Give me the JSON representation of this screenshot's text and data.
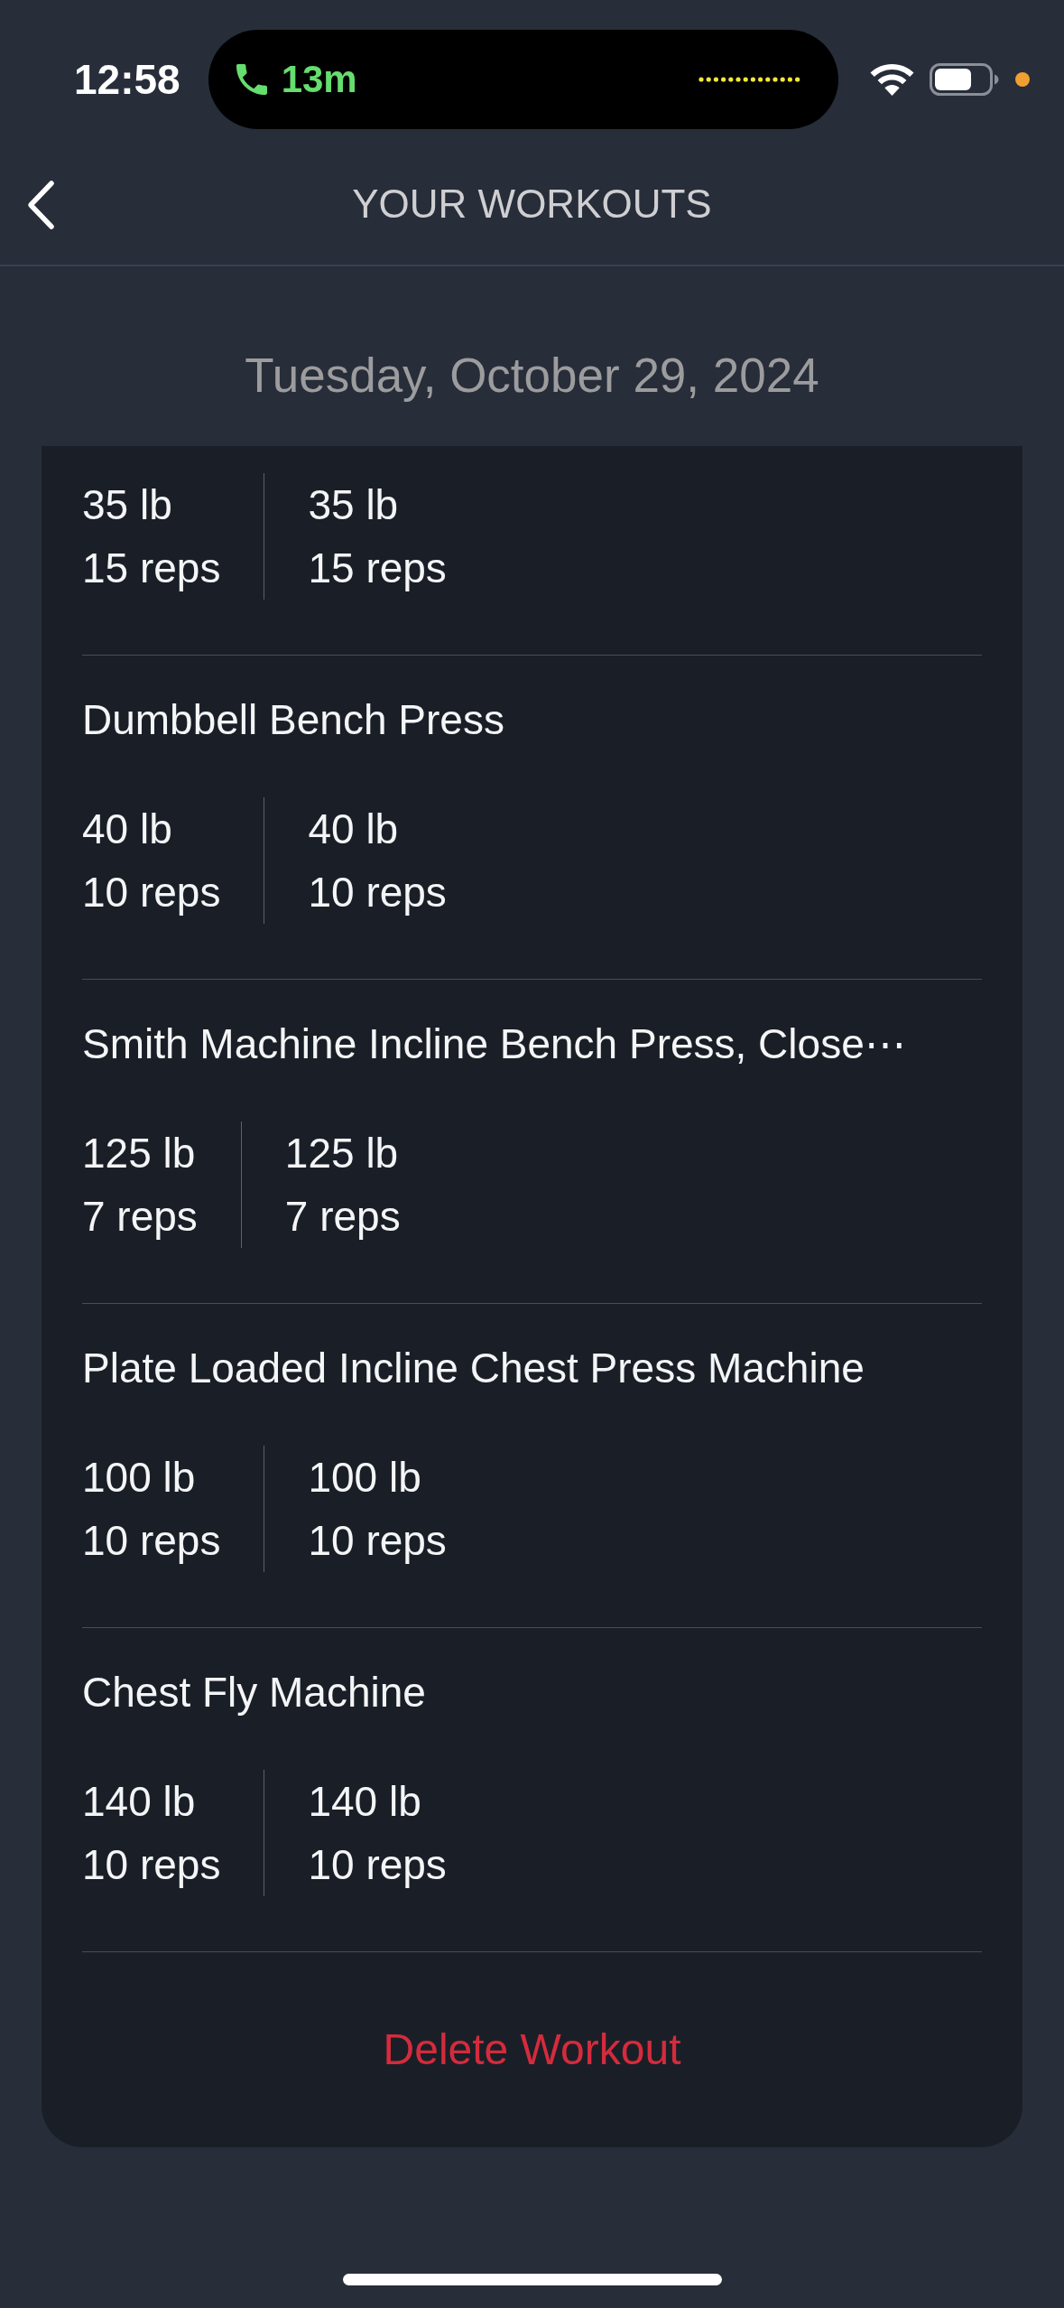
{
  "status_bar": {
    "time": "12:58",
    "call_duration": "13m"
  },
  "header": {
    "title": "YOUR WORKOUTS"
  },
  "date": "Tuesday, October 29, 2024",
  "exercises": [
    {
      "sets": [
        {
          "weight": "35 lb",
          "reps": "15 reps"
        },
        {
          "weight": "35 lb",
          "reps": "15 reps"
        }
      ]
    },
    {
      "name": "Dumbbell Bench Press",
      "sets": [
        {
          "weight": "40 lb",
          "reps": "10 reps"
        },
        {
          "weight": "40 lb",
          "reps": "10 reps"
        }
      ]
    },
    {
      "name": "Smith Machine Incline Bench Press, Close⋯",
      "sets": [
        {
          "weight": "125 lb",
          "reps": "7 reps"
        },
        {
          "weight": "125 lb",
          "reps": "7 reps"
        }
      ]
    },
    {
      "name": "Plate Loaded Incline Chest Press Machine",
      "sets": [
        {
          "weight": "100 lb",
          "reps": "10 reps"
        },
        {
          "weight": "100 lb",
          "reps": "10 reps"
        }
      ]
    },
    {
      "name": "Chest Fly Machine",
      "sets": [
        {
          "weight": "140 lb",
          "reps": "10 reps"
        },
        {
          "weight": "140 lb",
          "reps": "10 reps"
        }
      ]
    }
  ],
  "delete_button": {
    "label": "Delete Workout"
  }
}
